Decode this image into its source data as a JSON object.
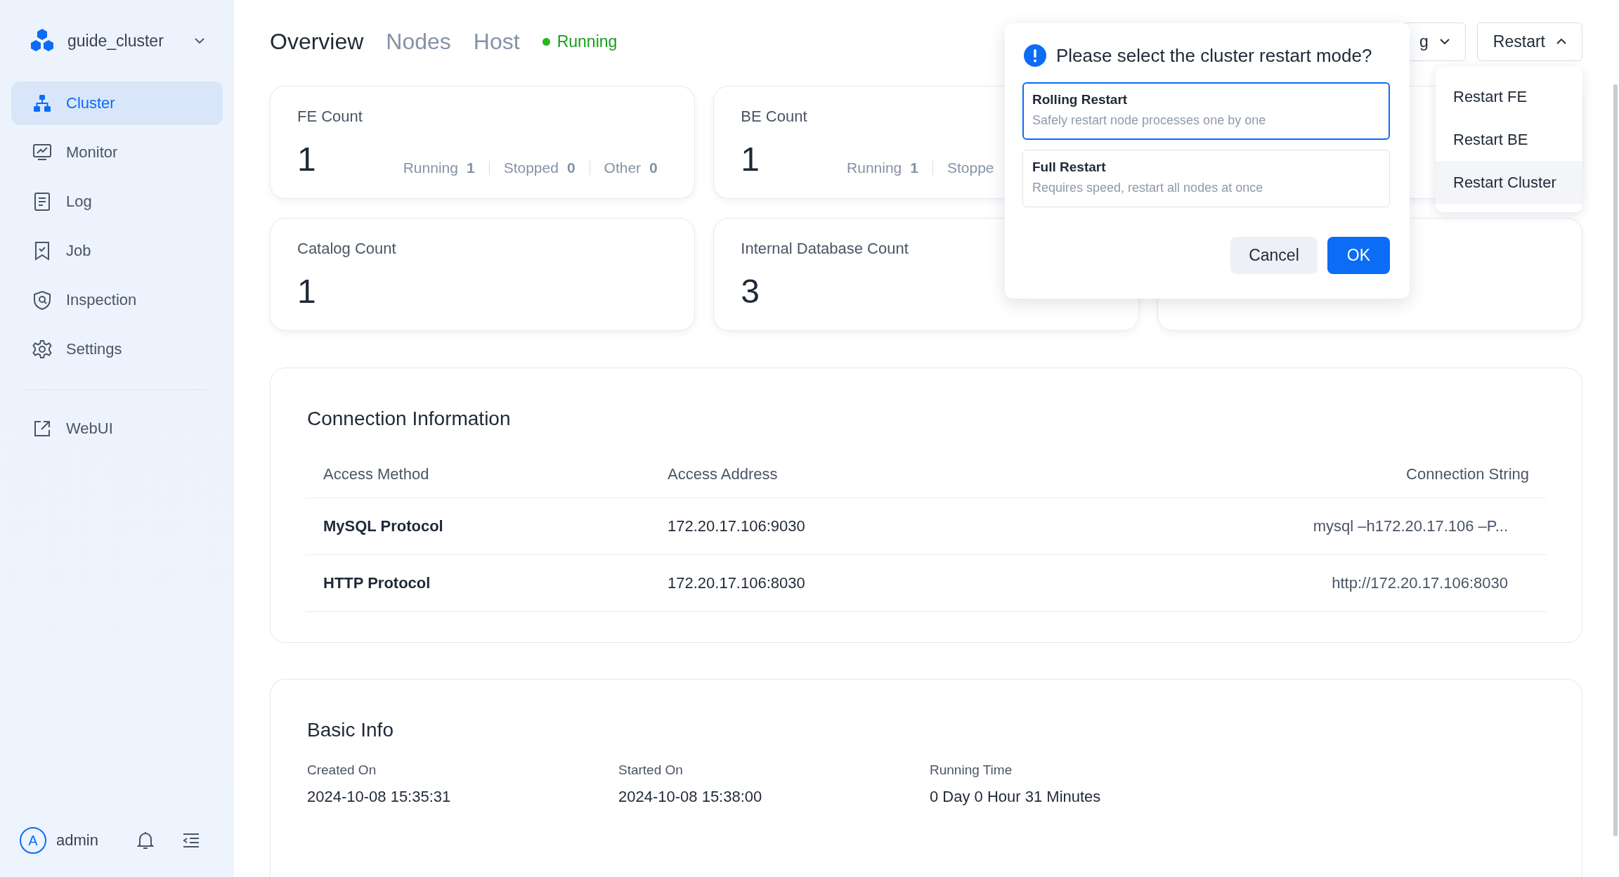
{
  "sidebar": {
    "cluster_name": "guide_cluster",
    "items": [
      {
        "label": "Cluster",
        "selected": true
      },
      {
        "label": "Monitor",
        "selected": false
      },
      {
        "label": "Log",
        "selected": false
      },
      {
        "label": "Job",
        "selected": false
      },
      {
        "label": "Inspection",
        "selected": false
      },
      {
        "label": "Settings",
        "selected": false
      }
    ],
    "links": [
      {
        "label": "WebUI"
      }
    ],
    "user": {
      "initial": "A",
      "name": "admin"
    }
  },
  "header": {
    "tabs": [
      {
        "label": "Overview",
        "selected": true
      },
      {
        "label": "Nodes",
        "selected": false
      },
      {
        "label": "Host",
        "selected": false
      }
    ],
    "status": "Running",
    "buttons": [
      {
        "label": "g",
        "expanded": false
      },
      {
        "label": "Restart",
        "expanded": true
      }
    ]
  },
  "stat_cards": [
    {
      "label": "FE Count",
      "value": "1",
      "breakdown": [
        {
          "label": "Running",
          "value": "1"
        },
        {
          "label": "Stopped",
          "value": "0"
        },
        {
          "label": "Other",
          "value": "0"
        }
      ]
    },
    {
      "label": "BE Count",
      "value": "1",
      "breakdown": [
        {
          "label": "Running",
          "value": "1"
        },
        {
          "label": "Stoppe"
        }
      ]
    },
    {
      "label": "Catalog Count",
      "value": "1"
    },
    {
      "label": "Internal Database Count",
      "value": "3"
    }
  ],
  "connection": {
    "title": "Connection Information",
    "columns": [
      "Access Method",
      "Access Address",
      "Connection String"
    ],
    "rows": [
      {
        "method": "MySQL Protocol",
        "address": "172.20.17.106:9030",
        "string": "mysql –h172.20.17.106 –P..."
      },
      {
        "method": "HTTP Protocol",
        "address": "172.20.17.106:8030",
        "string": "http://172.20.17.106:8030"
      }
    ]
  },
  "basic_info": {
    "title": "Basic Info",
    "fields": [
      {
        "label": "Created On",
        "value": "2024-10-08 15:35:31"
      },
      {
        "label": "Started On",
        "value": "2024-10-08 15:38:00"
      },
      {
        "label": "Running Time",
        "value": "0 Day 0 Hour 31 Minutes"
      }
    ]
  },
  "restart_dialog": {
    "title": "Please select the cluster restart mode?",
    "options": [
      {
        "title": "Rolling Restart",
        "description": "Safely restart node processes one by one",
        "selected": true
      },
      {
        "title": "Full Restart",
        "description": "Requires speed, restart all nodes at once",
        "selected": false
      }
    ],
    "buttons": [
      {
        "label": "Cancel",
        "kind": "secondary"
      },
      {
        "label": "OK",
        "kind": "primary"
      }
    ]
  },
  "restart_menu": [
    {
      "label": "Restart FE",
      "highlighted": false
    },
    {
      "label": "Restart BE",
      "highlighted": false
    },
    {
      "label": "Restart Cluster",
      "highlighted": true
    }
  ]
}
